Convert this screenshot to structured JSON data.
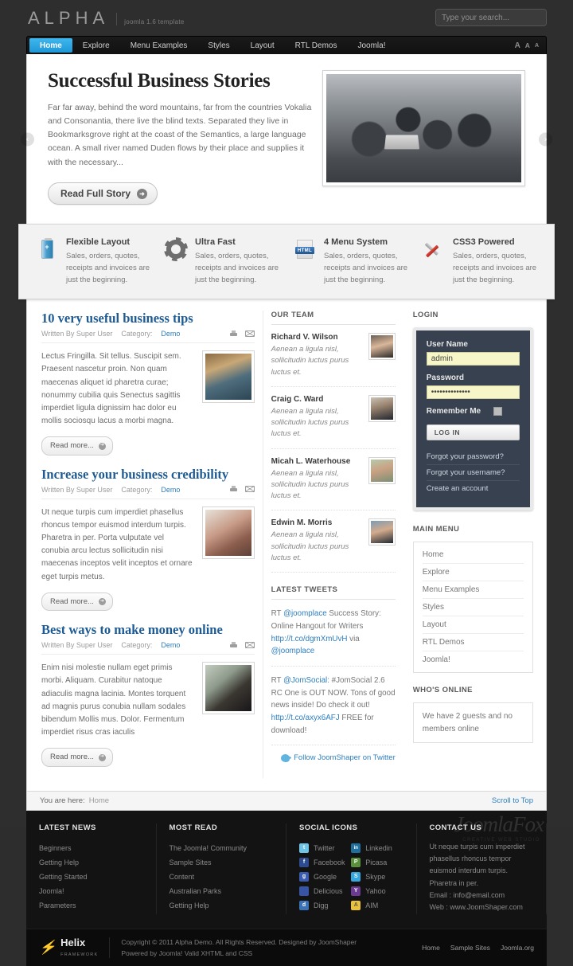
{
  "header": {
    "logo": "ALPHA",
    "logo_sub": "joomla 1.6 template",
    "search_placeholder": "Type your search...",
    "search_value": "",
    "font_large": "A",
    "font_medium": "A",
    "font_small": "A"
  },
  "nav": {
    "items": [
      {
        "label": "Home",
        "active": true
      },
      {
        "label": "Explore",
        "active": false
      },
      {
        "label": "Menu Examples",
        "active": false
      },
      {
        "label": "Styles",
        "active": false
      },
      {
        "label": "Layout",
        "active": false
      },
      {
        "label": "RTL Demos",
        "active": false
      },
      {
        "label": "Joomla!",
        "active": false
      }
    ]
  },
  "slider": {
    "title": "Successful Business Stories",
    "body": "Far far away, behind the word mountains, far from the countries Vokalia and Consonantia, there live the blind texts. Separated they live in Bookmarksgrove right at the coast of the Semantics, a large language ocean. A small river named Duden flows by their place and supplies it with the necessary...",
    "button": "Read Full Story",
    "prev": "‹",
    "next": "›"
  },
  "features": [
    {
      "icon": "battery-icon",
      "title": "Flexible Layout",
      "desc": "Sales, orders, quotes, receipts and invoices are just the beginning."
    },
    {
      "icon": "gear-icon",
      "title": "Ultra Fast",
      "desc": "Sales, orders, quotes, receipts and invoices are just the beginning."
    },
    {
      "icon": "html-file-icon",
      "title": "4 Menu System",
      "desc": "Sales, orders, quotes, receipts and invoices are just the beginning."
    },
    {
      "icon": "tools-icon",
      "title": "CSS3 Powered",
      "desc": "Sales, orders, quotes, receipts and invoices are just the beginning."
    }
  ],
  "articles": [
    {
      "title": "10 very useful business tips",
      "author_label": "Written By Super User",
      "category_label": "Category:",
      "category": "Demo",
      "text": "Lectus Fringilla. Sit tellus. Suscipit sem. Praesent nascetur proin. Non quam maecenas aliquet id pharetra curae; nonummy cubilia quis Senectus sagittis imperdiet ligula dignissim hac dolor eu mollis sociosqu lacus a morbi magna.",
      "readmore": "Read more..."
    },
    {
      "title": "Increase your business credibility",
      "author_label": "Written By Super User",
      "category_label": "Category:",
      "category": "Demo",
      "text": "Ut neque turpis cum imperdiet phasellus rhoncus tempor euismod interdum turpis. Pharetra in per. Porta vulputate vel conubia arcu lectus sollicitudin nisi maecenas inceptos velit inceptos et ornare eget turpis metus.",
      "readmore": "Read more..."
    },
    {
      "title": "Best ways to make money online",
      "author_label": "Written By Super User",
      "category_label": "Category:",
      "category": "Demo",
      "text": "Enim nisi molestie nullam eget primis morbi. Aliquam. Curabitur natoque adiaculis magna lacinia. Montes torquent ad magnis purus conubia nullam sodales bibendum Mollis mus. Dolor. Fermentum imperdiet risus cras iaculis",
      "readmore": "Read more..."
    }
  ],
  "team": {
    "title": "OUR TEAM",
    "members": [
      {
        "name": "Richard V. Wilson",
        "desc": "Aenean a ligula nisl, sollicitudin luctus purus luctus et."
      },
      {
        "name": "Craig C. Ward",
        "desc": "Aenean a ligula nisl, sollicitudin luctus purus luctus et."
      },
      {
        "name": "Micah L. Waterhouse",
        "desc": "Aenean a ligula nisl, sollicitudin luctus purus luctus et."
      },
      {
        "name": "Edwin M. Morris",
        "desc": "Aenean a ligula nisl, sollicitudin luctus purus luctus et."
      }
    ]
  },
  "tweets": {
    "title": "LATEST TWEETS",
    "items": [
      {
        "pre": "RT ",
        "handle": "@joomplace",
        "mid": " Success Story: Online Hangout for Writers ",
        "link": "http://t.co/dgmXmUvH",
        "post": " via ",
        "handle2": "@joomplace"
      },
      {
        "pre": "RT ",
        "handle": "@JomSocial",
        "mid": ": #JomSocial 2.6 RC One is OUT NOW. Tons of good news inside! Do check it out! ",
        "link": "http://t.co/axyx6AFJ",
        "post": " FREE for download!",
        "handle2": ""
      }
    ],
    "follow": "Follow JoomShaper on Twitter"
  },
  "login": {
    "title": "LOGIN",
    "username_label": "User Name",
    "username_value": "admin",
    "password_label": "Password",
    "password_value": "••••••••••••••",
    "remember_label": "Remember Me",
    "button": "LOG IN",
    "links": [
      "Forgot your password?",
      "Forgot your username?",
      "Create an account"
    ]
  },
  "mainmenu": {
    "title": "MAIN MENU",
    "items": [
      "Home",
      "Explore",
      "Menu Examples",
      "Styles",
      "Layout",
      "RTL Demos",
      "Joomla!"
    ]
  },
  "whosonline": {
    "title": "WHO'S ONLINE",
    "text": "We have 2 guests and no members online"
  },
  "breadcrumb": {
    "label": "You are here:",
    "current": "Home",
    "scroll_top": "Scroll to Top"
  },
  "footer": {
    "latest_news": {
      "title": "LATEST NEWS",
      "links": [
        "Beginners",
        "Getting Help",
        "Getting Started",
        "Joomla!",
        "Parameters"
      ]
    },
    "most_read": {
      "title": "MOST READ",
      "links": [
        "The Joomla! Community",
        "Sample Sites",
        "Content",
        "Australian Parks",
        "Getting Help"
      ]
    },
    "social": {
      "title": "SOCIAL ICONS",
      "items": [
        {
          "label": "Twitter",
          "icon": "twitter-icon",
          "color": "#6fc4e8",
          "glyph": "t"
        },
        {
          "label": "Linkedin",
          "icon": "linkedin-icon",
          "color": "#1f6f9e",
          "glyph": "in"
        },
        {
          "label": "Facebook",
          "icon": "facebook-icon",
          "color": "#2d4b8e",
          "glyph": "f"
        },
        {
          "label": "Picasa",
          "icon": "picasa-icon",
          "color": "#5a8f3c",
          "glyph": "P"
        },
        {
          "label": "Google",
          "icon": "google-icon",
          "color": "#3b5bb0",
          "glyph": "g"
        },
        {
          "label": "Skype",
          "icon": "skype-icon",
          "color": "#36a7e0",
          "glyph": "S"
        },
        {
          "label": "Delicious",
          "icon": "delicious-icon",
          "color": "#3855a5",
          "glyph": ""
        },
        {
          "label": "Yahoo",
          "icon": "yahoo-icon",
          "color": "#6b3a93",
          "glyph": "Y"
        },
        {
          "label": "Digg",
          "icon": "digg-icon",
          "color": "#3b72b5",
          "glyph": "d"
        },
        {
          "label": "AIM",
          "icon": "aim-icon",
          "color": "#e8c23a",
          "glyph": "A"
        }
      ]
    },
    "contact": {
      "title": "CONTACT US",
      "text": "Ut neque turpis cum imperdiet phasellus rhoncus tempor euismod interdum turpis. Pharetra in per.",
      "email": "Email : info@email.com",
      "web": "Web : www.JoomShaper.com"
    },
    "watermark": "JoomlaFox",
    "watermark_sub": "CREATIVE WEB STUDIO"
  },
  "copyright": {
    "helix_name": "Helix",
    "helix_sub": "FRAMEWORK",
    "line1": "Copyright © 2011 Alpha Demo. All Rights Reserved. Designed by JoomShaper",
    "line2": "Powered by Joomla! Valid XHTML and CSS",
    "nav": [
      "Home",
      "Sample Sites",
      "Joomla.org"
    ]
  }
}
